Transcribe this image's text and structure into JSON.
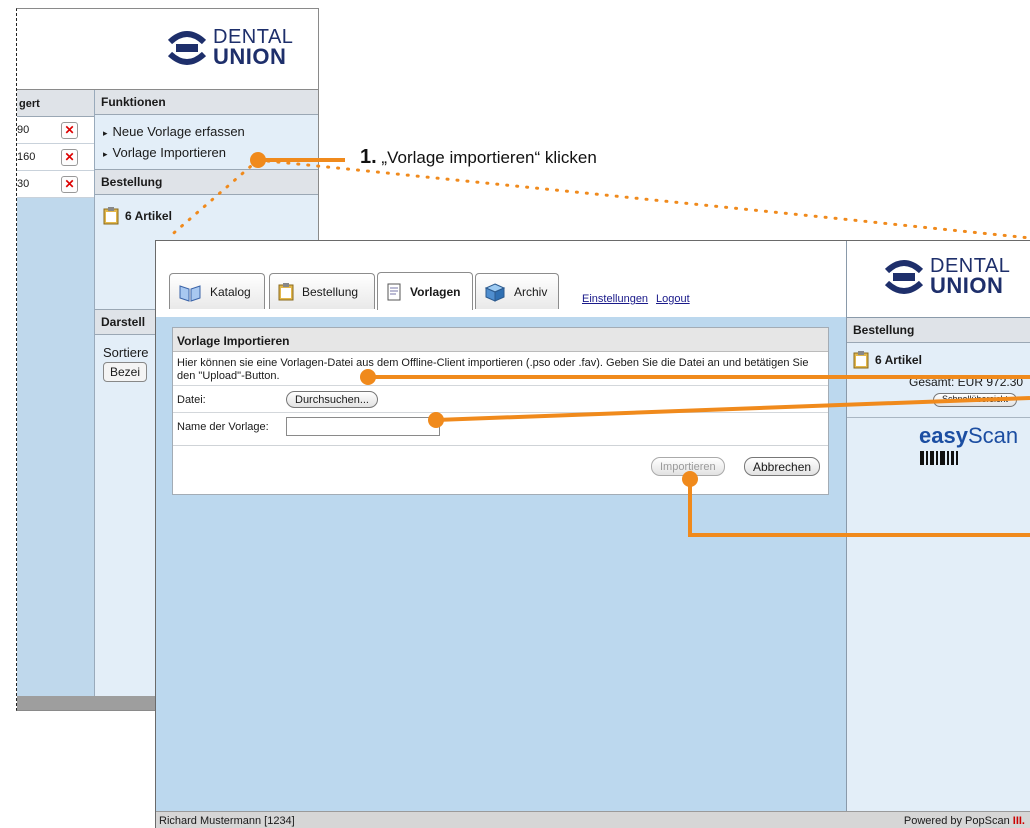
{
  "brand": {
    "line1": "DENTAL",
    "line2": "UNION"
  },
  "back_window": {
    "table": {
      "header": "gert",
      "rows": [
        {
          "value": "90"
        },
        {
          "value": "160"
        },
        {
          "value": "30"
        }
      ]
    },
    "funktionen": {
      "title": "Funktionen",
      "links": [
        "Neue Vorlage erfassen",
        "Vorlage Importieren"
      ]
    },
    "bestellung": {
      "title": "Bestellung",
      "count": "6 Artikel"
    },
    "darstellung": {
      "title": "Darstell",
      "sort_label": "Sortiere",
      "sort_button": "Bezei"
    }
  },
  "front_window": {
    "tabs": [
      {
        "label": "Katalog",
        "icon": "book-icon"
      },
      {
        "label": "Bestellung",
        "icon": "clipboard-icon"
      },
      {
        "label": "Vorlagen",
        "icon": "document-icon",
        "active": true
      },
      {
        "label": "Archiv",
        "icon": "cube-icon"
      }
    ],
    "links": {
      "settings": "Einstellungen",
      "logout": "Logout"
    },
    "dialog": {
      "title": "Vorlage Importieren",
      "description": "Hier können sie eine Vorlagen-Datei aus dem Offline-Client importieren (.pso oder .fav). Geben Sie die Datei an und betätigen Sie den \"Upload\"-Button.",
      "file_label": "Datei:",
      "browse_button": "Durchsuchen...",
      "name_label": "Name der Vorlage:",
      "name_value": "",
      "import_button": "Importieren",
      "cancel_button": "Abbrechen"
    },
    "sidebar": {
      "title": "Bestellung",
      "count": "6 Artikel",
      "total": "Gesamt: EUR 972.30",
      "overview_button": "Schnellübersicht",
      "easyscan_a": "easy",
      "easyscan_b": "Scan"
    },
    "status": {
      "user": "Richard Mustermann [1234]",
      "powered": "Powered by PopScan"
    }
  },
  "annotation": {
    "step_number": "1.",
    "step_text": "„Vorlage importieren“ klicken"
  },
  "colors": {
    "annotation_orange": "#f08a1c",
    "page_blue": "#bcd8ee",
    "panel_blue": "#e3eef8",
    "brand_navy": "#1e2f6b"
  }
}
